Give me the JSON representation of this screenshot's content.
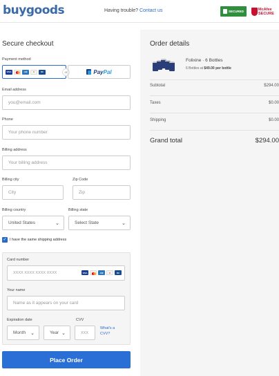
{
  "header": {
    "logo": "buygoods",
    "trouble_text": "Having trouble?",
    "contact_link": "Contact us",
    "secured_badge": "SECURED",
    "mcafee_line1": "McAfee",
    "mcafee_line2": "SECURE"
  },
  "checkout": {
    "title": "Secure checkout",
    "payment_method_label": "Payment method",
    "or_label": "or",
    "paypal_pay": "Pay",
    "paypal_pal": "Pal",
    "email_label": "Email address",
    "email_placeholder": "you@email.com",
    "phone_label": "Phone",
    "phone_placeholder": "Your phone number",
    "billing_address_label": "Billing address",
    "billing_address_placeholder": "Your billing address",
    "city_label": "Billing city",
    "city_placeholder": "City",
    "zip_label": "Zip Code",
    "zip_placeholder": "Zip",
    "country_label": "Billing country",
    "country_value": "United States",
    "state_label": "Billing state",
    "state_value": "Select State",
    "same_shipping_label": "I have the same shipping address",
    "same_shipping_checked": true,
    "card_number_label": "Card number",
    "card_number_placeholder": "XXXX XXXX XXXX XXXX",
    "name_label": "Your name",
    "name_placeholder": "Name as it appears on your card",
    "expiration_label": "Expiration date",
    "month_value": "Month",
    "year_value": "Year",
    "cvv_label": "CVV",
    "cvv_placeholder": "XXX",
    "whats_cvv_line1": "What's a",
    "whats_cvv_line2": "CVV?",
    "place_order": "Place Order",
    "card_icons": [
      "visa-icon",
      "mastercard-icon",
      "amex-icon",
      "discover-icon",
      "diners-icon"
    ]
  },
  "order": {
    "title": "Order details",
    "product_name": "Folixine · 6 Bottles",
    "product_sub_prefix": "6 Bottles at",
    "product_sub_price": "$49.00 per bottle",
    "subtotal_label": "Subtotal",
    "subtotal_value": "$294.00",
    "taxes_label": "Taxes",
    "taxes_value": "$0.00",
    "shipping_label": "Shipping",
    "shipping_value": "$0.00",
    "grand_label": "Grand total",
    "grand_value": "$294.00"
  },
  "colors": {
    "accent": "#2a6fd6",
    "link": "#2a6ac8",
    "secured_green": "#2f8f3e",
    "mcafee_red": "#c8102e"
  }
}
